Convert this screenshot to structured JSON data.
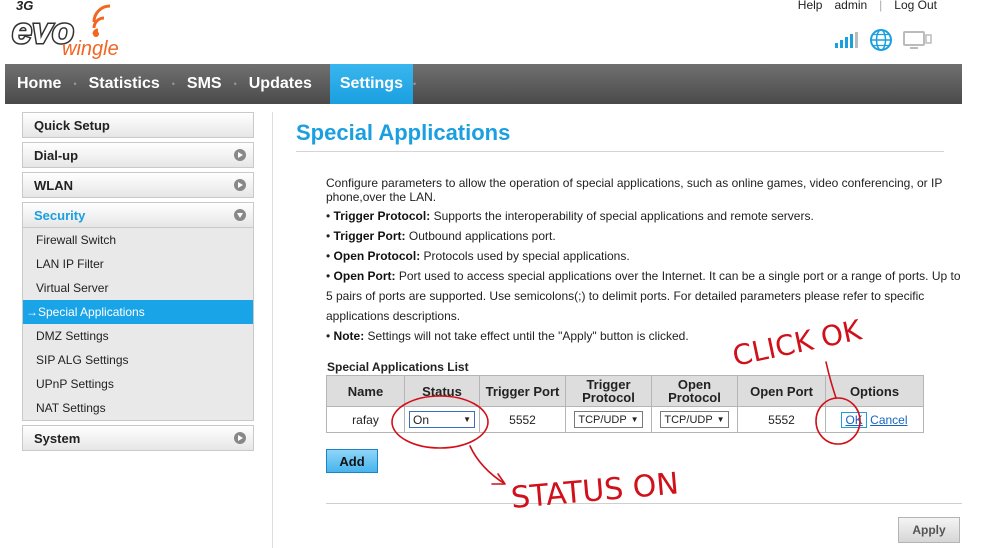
{
  "brand": {
    "prefix": "3G",
    "name": "evo",
    "suffix": "wingle"
  },
  "toplinks": {
    "help": "Help",
    "user": "admin",
    "logout": "Log Out"
  },
  "nav": [
    {
      "label": "Home"
    },
    {
      "label": "Statistics"
    },
    {
      "label": "SMS"
    },
    {
      "label": "Updates"
    },
    {
      "label": "Settings",
      "active": true
    }
  ],
  "sidebar": {
    "quick_setup": "Quick Setup",
    "dialup": "Dial-up",
    "wlan": "WLAN",
    "security": "Security",
    "security_items": [
      "Firewall Switch",
      "LAN IP Filter",
      "Virtual Server",
      "→Special Applications",
      "DMZ Settings",
      "SIP ALG Settings",
      "UPnP Settings",
      "NAT Settings"
    ],
    "system": "System"
  },
  "page": {
    "title": "Special Applications",
    "description": "Configure parameters to allow the operation of special applications, such as online games, video conferencing, or IP phone,over the LAN.",
    "bullets": [
      {
        "term": "Trigger Protocol:",
        "text": " Supports the interoperability of special applications and remote servers."
      },
      {
        "term": "Trigger Port:",
        "text": " Outbound applications port."
      },
      {
        "term": "Open Protocol:",
        "text": " Protocols used by special applications."
      },
      {
        "term": "Open Port:",
        "text": " Port used to access special applications over the Internet. It can be a single port or a range of ports. Up to 5 pairs of ports are supported. Use semicolons(;) to delimit ports. For detailed parameters please refer to specific applications descriptions."
      },
      {
        "term": "Note:",
        "text": " Settings will not take effect until the \"Apply\" button is clicked."
      }
    ],
    "list_title": "Special Applications List",
    "table": {
      "headers": [
        "Name",
        "Status",
        "Trigger Port",
        "Trigger Protocol",
        "Open Protocol",
        "Open Port",
        "Options"
      ],
      "row": {
        "name": "rafay",
        "status": "On",
        "trigger_port": "5552",
        "trigger_protocol": "TCP/UDP",
        "open_protocol": "TCP/UDP",
        "open_port": "5552",
        "ok": "OK",
        "cancel": "Cancel"
      }
    },
    "add_label": "Add",
    "apply_label": "Apply"
  },
  "annotations": {
    "click_ok": "CLICK OK",
    "status_on": "STATUS ON"
  },
  "colors": {
    "accent": "#1a9fe0",
    "annotation": "#d0101a"
  }
}
